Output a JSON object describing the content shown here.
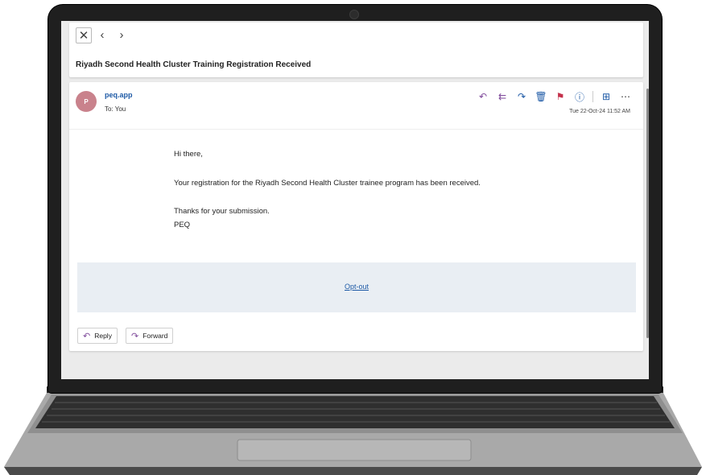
{
  "email": {
    "subject": "Riyadh Second Health Cluster Training Registration Received",
    "sender_initial": "P",
    "sender": "peq.app",
    "to_line": "To: You",
    "timestamp": "Tue 22-Oct-24 11:52 AM",
    "body": {
      "greeting": "Hi there,",
      "paragraph": "Your registration for the Riyadh Second Health Cluster trainee program has been received.",
      "thanks": "Thanks for your submission.",
      "signature": "PEQ"
    },
    "opt_out_label": "Opt-out"
  },
  "toolbar": {
    "reply_label": "Reply",
    "forward_label": "Forward"
  },
  "colors": {
    "accent": "#1e5aa6",
    "avatar": "#c9828c",
    "flag": "#c4314b",
    "reply_icon": "#7f4a9b"
  }
}
